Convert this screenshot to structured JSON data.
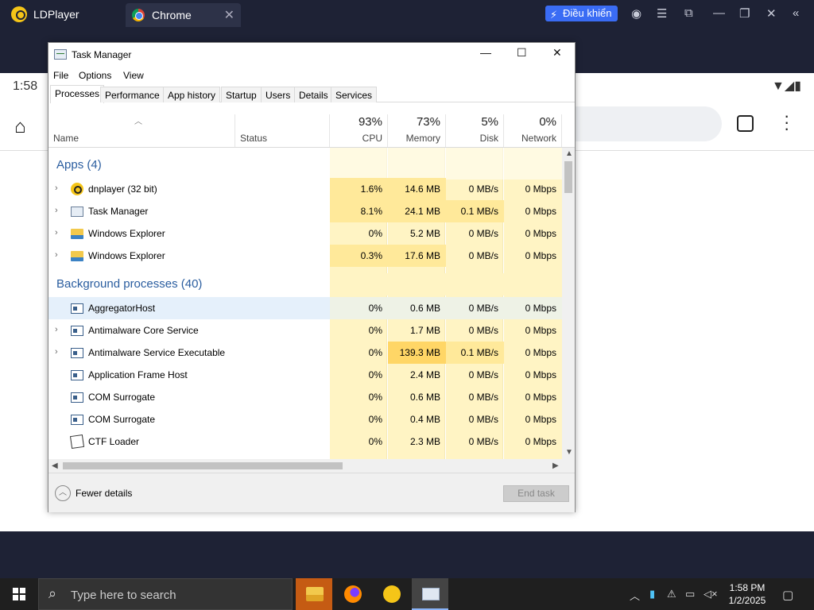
{
  "emulator": {
    "title": "LDPlayer",
    "tab_label": "Chrome",
    "control_button": "Điều khiển"
  },
  "android": {
    "status_time": "1:58"
  },
  "task_manager": {
    "title": "Task Manager",
    "menu": [
      "File",
      "Options",
      "View"
    ],
    "tabs": [
      "Processes",
      "Performance",
      "App history",
      "Startup",
      "Users",
      "Details",
      "Services"
    ],
    "columns": {
      "name": "Name",
      "status": "Status",
      "cpu": {
        "label": "CPU",
        "pct": "93%"
      },
      "memory": {
        "label": "Memory",
        "pct": "73%"
      },
      "disk": {
        "label": "Disk",
        "pct": "5%"
      },
      "network": {
        "label": "Network",
        "pct": "0%"
      }
    },
    "groups": [
      {
        "title": "Apps (4)"
      },
      {
        "title": "Background processes (40)"
      }
    ],
    "apps": [
      {
        "name": "dnplayer (32 bit)",
        "cpu": "1.6%",
        "memory": "14.6 MB",
        "disk": "0 MB/s",
        "network": "0 Mbps"
      },
      {
        "name": "Task Manager",
        "cpu": "8.1%",
        "memory": "24.1 MB",
        "disk": "0.1 MB/s",
        "network": "0 Mbps"
      },
      {
        "name": "Windows Explorer",
        "cpu": "0%",
        "memory": "5.2 MB",
        "disk": "0 MB/s",
        "network": "0 Mbps"
      },
      {
        "name": "Windows Explorer",
        "cpu": "0.3%",
        "memory": "17.6 MB",
        "disk": "0 MB/s",
        "network": "0 Mbps"
      }
    ],
    "background": [
      {
        "name": "AggregatorHost",
        "cpu": "0%",
        "memory": "0.6 MB",
        "disk": "0 MB/s",
        "network": "0 Mbps"
      },
      {
        "name": "Antimalware Core Service",
        "cpu": "0%",
        "memory": "1.7 MB",
        "disk": "0 MB/s",
        "network": "0 Mbps"
      },
      {
        "name": "Antimalware Service Executable",
        "cpu": "0%",
        "memory": "139.3 MB",
        "disk": "0.1 MB/s",
        "network": "0 Mbps"
      },
      {
        "name": "Application Frame Host",
        "cpu": "0%",
        "memory": "2.4 MB",
        "disk": "0 MB/s",
        "network": "0 Mbps"
      },
      {
        "name": "COM Surrogate",
        "cpu": "0%",
        "memory": "0.6 MB",
        "disk": "0 MB/s",
        "network": "0 Mbps"
      },
      {
        "name": "COM Surrogate",
        "cpu": "0%",
        "memory": "0.4 MB",
        "disk": "0 MB/s",
        "network": "0 Mbps"
      },
      {
        "name": "CTF Loader",
        "cpu": "0%",
        "memory": "2.3 MB",
        "disk": "0 MB/s",
        "network": "0 Mbps"
      }
    ],
    "fewer_details": "Fewer details",
    "end_task": "End task"
  },
  "taskbar": {
    "search_placeholder": "Type here to search",
    "time": "1:58 PM",
    "date": "1/2/2025"
  },
  "colors": {
    "heat_light": "#fff4c4",
    "heat_medium": "#ffe99a",
    "heat_strong": "#ffd666",
    "group_blue": "#2a5d9f",
    "selection": "#e5f0fb"
  }
}
